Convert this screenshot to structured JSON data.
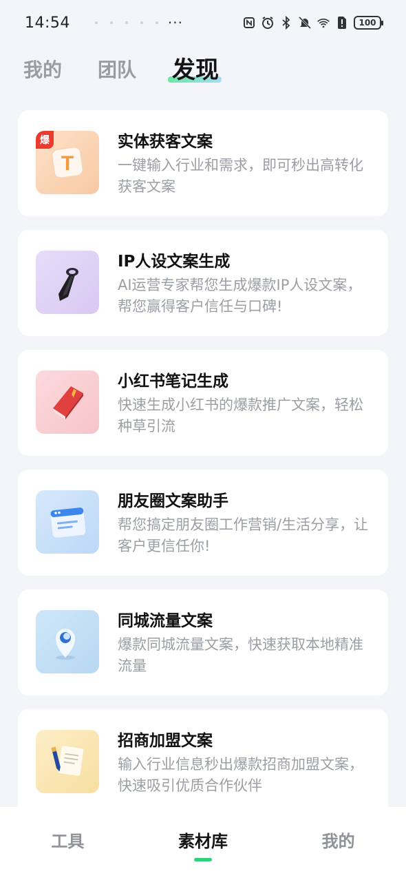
{
  "status_bar": {
    "time": "14:54",
    "more": "···",
    "battery": "100"
  },
  "top_tabs": [
    {
      "label": "我的"
    },
    {
      "label": "团队"
    },
    {
      "label": "发现"
    }
  ],
  "cards": [
    {
      "title": "实体获客文案",
      "desc": "一键输入行业和需求，即可秒出高转化获客文案",
      "badge": "爆",
      "icon": "t-cube-icon"
    },
    {
      "title": "IP人设文案生成",
      "desc": "AI运营专家帮您生成爆款IP人设文案，帮您赢得客户信任与口碑!",
      "icon": "necktie-icon"
    },
    {
      "title": "小红书笔记生成",
      "desc": "快速生成小红书的爆款推广文案，轻松种草引流",
      "icon": "red-book-icon"
    },
    {
      "title": "朋友圈文案助手",
      "desc": "帮您搞定朋友圈工作营销/生活分享，让客户更信任你!",
      "icon": "browser-window-icon"
    },
    {
      "title": "同城流量文案",
      "desc": "爆款同城流量文案，快速获取本地精准流量",
      "icon": "location-pin-icon"
    },
    {
      "title": "招商加盟文案",
      "desc": "输入行业信息秒出爆款招商加盟文案，快速吸引优质合作伙伴",
      "icon": "pen-document-icon"
    }
  ],
  "bottom_nav": [
    {
      "label": "工具"
    },
    {
      "label": "素材库"
    },
    {
      "label": "我的"
    }
  ],
  "colors": {
    "accent": "#2fd27b",
    "hot_badge": "#ea3b2e"
  }
}
